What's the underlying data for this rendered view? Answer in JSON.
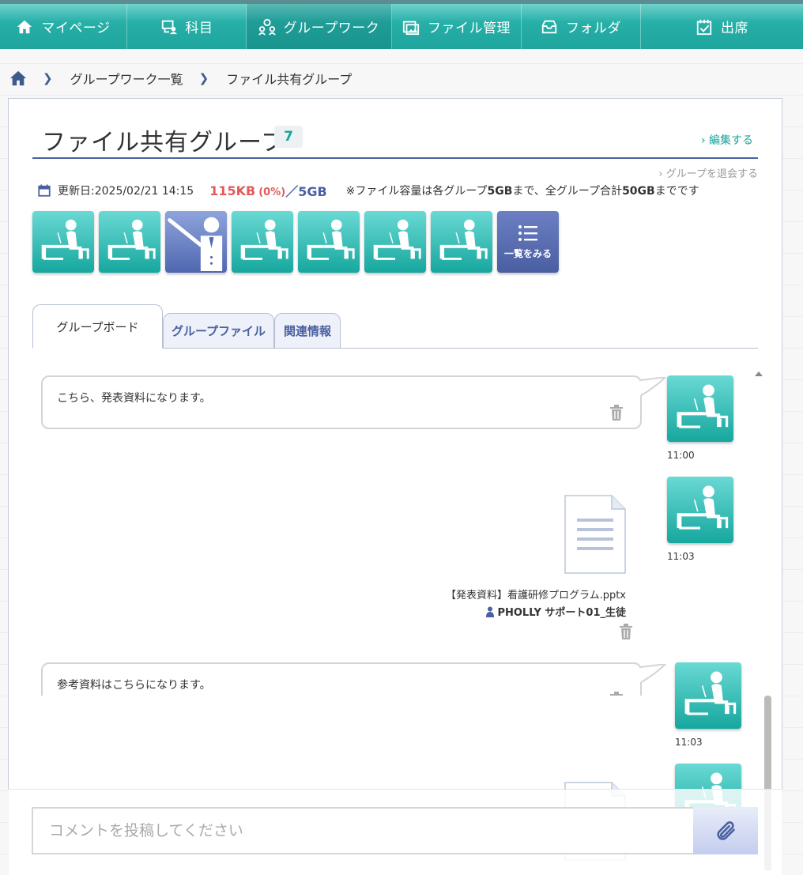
{
  "nav": {
    "items": [
      {
        "label": "マイページ",
        "icon": "home-icon"
      },
      {
        "label": "科目",
        "icon": "subject-icon"
      },
      {
        "label": "グループワーク",
        "icon": "group-icon"
      },
      {
        "label": "ファイル管理",
        "icon": "file-manage-icon"
      },
      {
        "label": "フォルダ",
        "icon": "folder-icon"
      },
      {
        "label": "出席",
        "icon": "attendance-icon"
      }
    ]
  },
  "breadcrumb": {
    "items": [
      "グループワーク一覧",
      "ファイル共有グループ"
    ]
  },
  "group": {
    "title": "ファイル共有グループ",
    "member_count": "7",
    "edit_label": "編集する",
    "leave_label": "グループを退会する",
    "updated": "更新日:2025/02/21 14:15",
    "used": "115KB",
    "used_percent": "(0%)",
    "total": "／5GB",
    "note_prefix": "※ファイル容量は各グループ",
    "note_limit1": "5GB",
    "note_mid": "まで、全グループ合計",
    "note_limit2": "50GB",
    "note_suffix": "までです",
    "see_all_label": "一覧をみる"
  },
  "tabs": [
    {
      "label": "グループボード"
    },
    {
      "label": "グループファイル"
    },
    {
      "label": "関連情報"
    }
  ],
  "messages": [
    {
      "type": "text",
      "text": "こちら、発表資料になります。",
      "time": "11:00"
    },
    {
      "type": "file",
      "file_name": "【発表資料】看護研修プログラム.pptx",
      "owner": "PHOLLY サポート01_生徒",
      "time": "11:03"
    },
    {
      "type": "text",
      "text": "参考資料はこちらになります。",
      "time": "11:03"
    }
  ],
  "comment": {
    "placeholder": "コメントを投稿してください"
  },
  "colors": {
    "nav_teal": "#1ea59d",
    "accent_navy": "#4a60a1",
    "used_red": "#e05b5b",
    "student_avatar": "#16a79e",
    "teacher_avatar": "#4f67b0"
  }
}
